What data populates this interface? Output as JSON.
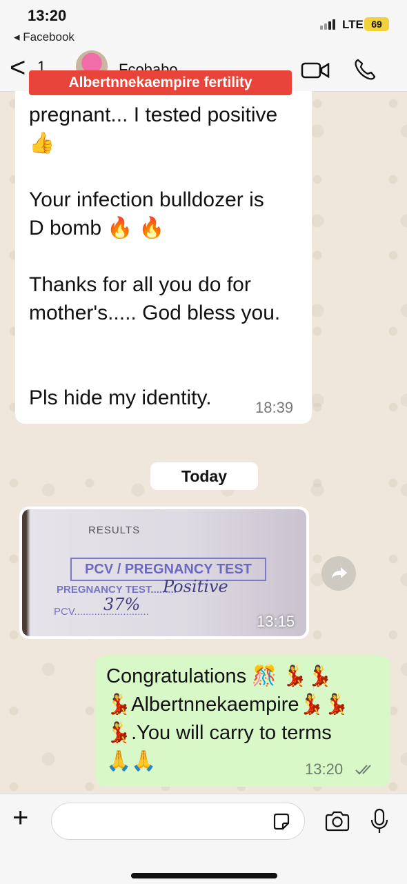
{
  "status": {
    "time": "13:20",
    "back_app": "◂ Facebook",
    "network": "LTE",
    "battery": "69"
  },
  "header": {
    "back_label": "<",
    "unread": "1",
    "contact_name": "Fcobabo"
  },
  "banner": "Albertnnekaempire fertility",
  "incoming": {
    "lines": [
      "pregnant... I tested positive",
      "👍",
      "",
      "Your infection bulldozer is",
      "D bomb 🔥 🔥",
      "",
      "Thanks for all you do for",
      "mother's..... God bless you.",
      "",
      "",
      "Pls hide my identity."
    ],
    "time": "18:39"
  },
  "date_divider": "Today",
  "image_message": {
    "results_label": "RESULTS",
    "stamp_title": "PCV / PREGNANCY TEST",
    "stamp_pregnancy": "PREGNANCY TEST.........",
    "stamp_pcv": "PCV..........................",
    "handwritten_result": "Positive",
    "handwritten_pcv": "37%",
    "time": "13:15"
  },
  "outgoing": {
    "lines": [
      "Congratulations 🎊 💃💃",
      "💃Albertnnekaempire💃💃",
      "💃.You will carry to terms",
      "🙏🙏"
    ],
    "time": "13:20"
  },
  "composer": {
    "placeholder": ""
  }
}
